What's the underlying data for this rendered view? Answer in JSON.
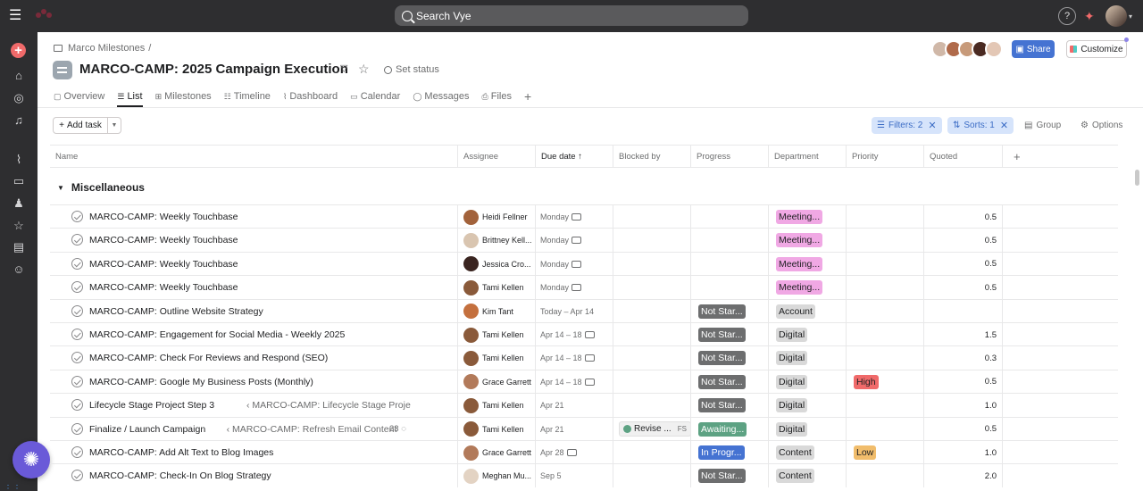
{
  "topbar": {
    "search_placeholder": "Search Vye"
  },
  "project": {
    "breadcrumb": "Marco Milestones",
    "breadcrumb_sep": "/",
    "title": "MARCO-CAMP: 2025 Campaign Execution",
    "set_status": "Set status",
    "share_label": "Share",
    "customize_label": "Customize"
  },
  "tabs": [
    {
      "label": "Overview",
      "icon": "overview-icon"
    },
    {
      "label": "List",
      "icon": "list-icon",
      "active": true
    },
    {
      "label": "Milestones",
      "icon": "milestone-icon"
    },
    {
      "label": "Timeline",
      "icon": "timeline-icon"
    },
    {
      "label": "Dashboard",
      "icon": "dashboard-icon"
    },
    {
      "label": "Calendar",
      "icon": "calendar-icon"
    },
    {
      "label": "Messages",
      "icon": "messages-icon"
    },
    {
      "label": "Files",
      "icon": "files-icon"
    }
  ],
  "toolbar": {
    "add_task": "Add task",
    "filters": "Filters: 2",
    "sorts": "Sorts: 1",
    "group": "Group",
    "options": "Options"
  },
  "columns": {
    "name": "Name",
    "assignee": "Assignee",
    "due": "Due date",
    "blocked": "Blocked by",
    "progress": "Progress",
    "department": "Department",
    "priority": "Priority",
    "quoted": "Quoted"
  },
  "section": {
    "name": "Miscellaneous"
  },
  "colors": {
    "meeting": "#f0a8e4",
    "neutral": "#d9d9d9",
    "not_started": "#6d6e6f",
    "awaiting": "#5da283",
    "in_progress": "#4573d2",
    "high": "#f06a6a",
    "low": "#f1bd6c"
  },
  "tasks": [
    {
      "name": "MARCO-CAMP: Weekly Touchbase",
      "parent": "",
      "comments": "",
      "assignee": "Heidi Fellner",
      "avatar": "#a2623b",
      "due": "Monday",
      "due_icon": true,
      "blocked": "",
      "progress": "",
      "department": "Meeting...",
      "priority": "",
      "quoted": "0.5"
    },
    {
      "name": "MARCO-CAMP: Weekly Touchbase",
      "parent": "",
      "comments": "",
      "assignee": "Brittney Kell...",
      "avatar": "#d9c5b0",
      "due": "Monday",
      "due_icon": true,
      "blocked": "",
      "progress": "",
      "department": "Meeting...",
      "priority": "",
      "quoted": "0.5"
    },
    {
      "name": "MARCO-CAMP: Weekly Touchbase",
      "parent": "",
      "comments": "",
      "assignee": "Jessica Cro...",
      "avatar": "#3a2420",
      "due": "Monday",
      "due_icon": true,
      "blocked": "",
      "progress": "",
      "department": "Meeting...",
      "priority": "",
      "quoted": "0.5"
    },
    {
      "name": "MARCO-CAMP: Weekly Touchbase",
      "parent": "",
      "comments": "",
      "assignee": "Tami Kellen",
      "avatar": "#8a5a3a",
      "due": "Monday",
      "due_icon": true,
      "blocked": "",
      "progress": "",
      "department": "Meeting...",
      "priority": "",
      "quoted": "0.5"
    },
    {
      "name": "MARCO-CAMP: Outline Website Strategy",
      "parent": "",
      "comments": "",
      "assignee": "Kim Tant",
      "avatar": "#c4703e",
      "due": "Today – Apr 14",
      "due_icon": false,
      "blocked": "",
      "progress": "Not Star...",
      "department": "Account",
      "priority": "",
      "quoted": ""
    },
    {
      "name": "MARCO-CAMP: Engagement for Social Media - Weekly 2025",
      "parent": "",
      "comments": "",
      "assignee": "Tami Kellen",
      "avatar": "#8a5a3a",
      "due": "Apr 14 – 18",
      "due_icon": true,
      "blocked": "",
      "progress": "Not Star...",
      "department": "Digital",
      "priority": "",
      "quoted": "1.5"
    },
    {
      "name": "MARCO-CAMP: Check For Reviews and Respond (SEO)",
      "parent": "",
      "comments": "",
      "assignee": "Tami Kellen",
      "avatar": "#8a5a3a",
      "due": "Apr 14 – 18",
      "due_icon": true,
      "blocked": "",
      "progress": "Not Star...",
      "department": "Digital",
      "priority": "",
      "quoted": "0.3"
    },
    {
      "name": "MARCO-CAMP: Google My Business Posts (Monthly)",
      "parent": "",
      "comments": "",
      "assignee": "Grace Garrett",
      "avatar": "#b27a5a",
      "due": "Apr 14 – 18",
      "due_icon": true,
      "blocked": "",
      "progress": "Not Star...",
      "department": "Digital",
      "priority": "High",
      "quoted": "0.5"
    },
    {
      "name": "Lifecycle Stage Project Step 3",
      "parent": "‹ MARCO-CAMP: Lifecycle Stage Project Ste",
      "comments": "",
      "assignee": "Tami Kellen",
      "avatar": "#8a5a3a",
      "due": "Apr 21",
      "due_icon": false,
      "blocked": "",
      "progress": "Not Star...",
      "department": "Digital",
      "priority": "",
      "quoted": "1.0"
    },
    {
      "name": "Finalize / Launch Campaign",
      "parent": "‹ MARCO-CAMP: Refresh Email Content",
      "comments": "23",
      "assignee": "Tami Kellen",
      "avatar": "#8a5a3a",
      "due": "Apr 21",
      "due_icon": false,
      "blocked": "Revise ...",
      "progress": "Awaiting...",
      "department": "Digital",
      "priority": "",
      "quoted": "0.5"
    },
    {
      "name": "MARCO-CAMP: Add Alt Text to Blog Images",
      "parent": "",
      "comments": "",
      "assignee": "Grace Garrett",
      "avatar": "#b27a5a",
      "due": "Apr 28",
      "due_icon": true,
      "blocked": "",
      "progress": "In Progr...",
      "department": "Content",
      "priority": "Low",
      "quoted": "1.0"
    },
    {
      "name": "MARCO-CAMP: Check-In On Blog Strategy",
      "parent": "",
      "comments": "",
      "assignee": "Meghan Mu...",
      "avatar": "#e3d3c3",
      "due": "Sep 5",
      "due_icon": false,
      "blocked": "",
      "progress": "Not Star...",
      "department": "Content",
      "priority": "",
      "quoted": "2.0"
    }
  ]
}
